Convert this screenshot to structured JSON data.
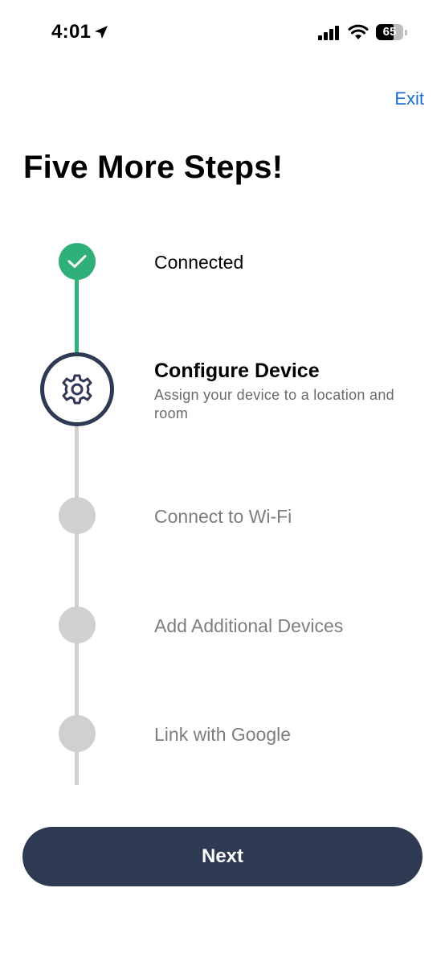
{
  "status_bar": {
    "time": "4:01",
    "battery_level": "65",
    "icons": [
      "location-arrow-icon",
      "signal-icon",
      "wifi-icon",
      "battery-icon"
    ]
  },
  "header": {
    "exit_label": "Exit"
  },
  "title": "Five More Steps!",
  "steps": [
    {
      "label": "Connected",
      "state": "done",
      "icon": "checkmark-icon"
    },
    {
      "label": "Configure Device",
      "description": "Assign your device to a location and room",
      "state": "current",
      "icon": "gear-icon"
    },
    {
      "label": "Connect to Wi-Fi",
      "state": "todo"
    },
    {
      "label": "Add Additional Devices",
      "state": "todo"
    },
    {
      "label": "Link with Google",
      "state": "todo"
    }
  ],
  "footer": {
    "next_label": "Next"
  },
  "colors": {
    "done": "#2fb07a",
    "current": "#2e3a52",
    "todo": "#d0d0d0",
    "link": "#1a6dd1",
    "button": "#2e3a52"
  }
}
